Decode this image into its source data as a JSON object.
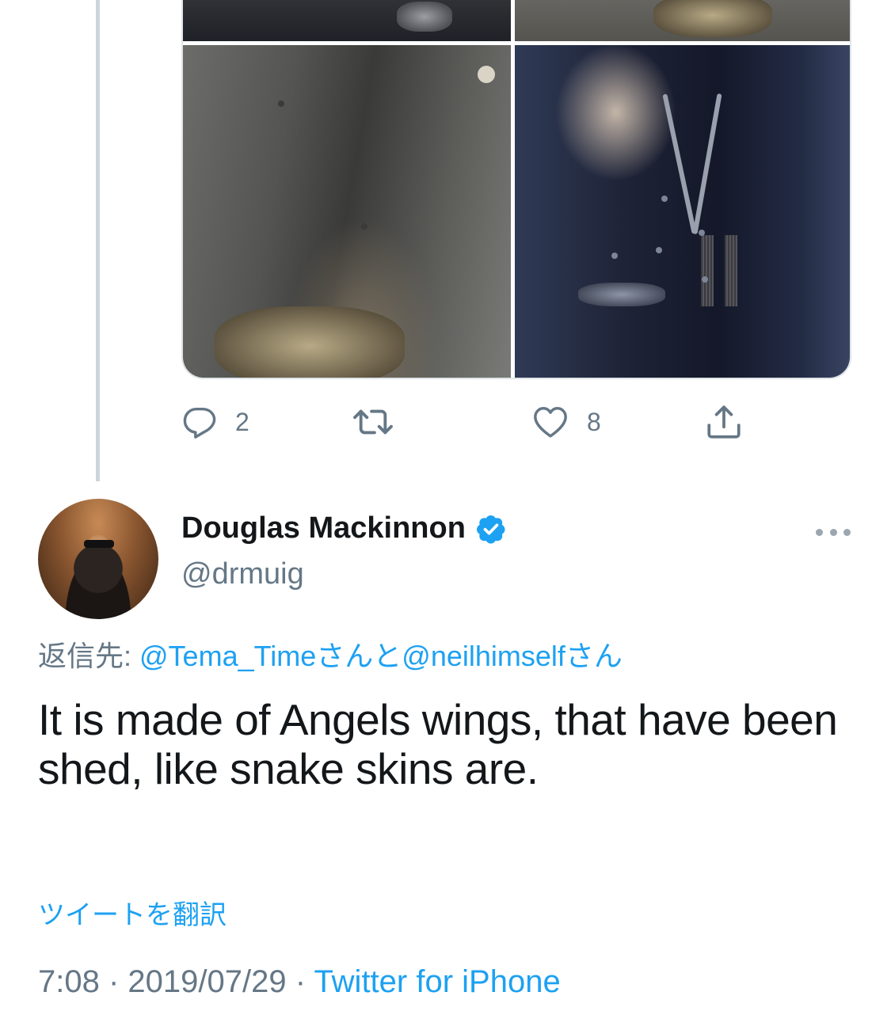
{
  "colors": {
    "link": "#1da1f2",
    "secondary_text": "#657786",
    "primary_text": "#14171a",
    "thread_line": "#cdd5dc",
    "verified_badge": "#1da1f2"
  },
  "previous_tweet": {
    "media": [
      {
        "description_icon": "photo-jacket-watch"
      },
      {
        "description_icon": "photo-belt-buckle"
      },
      {
        "description_icon": "photo-coat-buckle"
      },
      {
        "description_icon": "photo-bolo-tie"
      }
    ],
    "actions": {
      "reply": {
        "icon": "reply-icon",
        "count": "2"
      },
      "retweet": {
        "icon": "retweet-icon",
        "count": ""
      },
      "like": {
        "icon": "heart-icon",
        "count": "8"
      },
      "share": {
        "icon": "share-icon"
      }
    }
  },
  "tweet": {
    "author": {
      "display_name": "Douglas Mackinnon",
      "handle": "@drmuig",
      "verified": true
    },
    "reply_to": {
      "prefix": "返信先: ",
      "user1": "@Tema_Time",
      "honorific1": "さんと",
      "user2": "@neilhimself",
      "honorific2": "さん"
    },
    "text": "It is made of Angels wings, that have been shed, like snake skins are.",
    "translate_label": "ツイートを翻訳",
    "time": "7:08",
    "separator": " · ",
    "date": "2019/07/29",
    "source": "Twitter for iPhone"
  }
}
